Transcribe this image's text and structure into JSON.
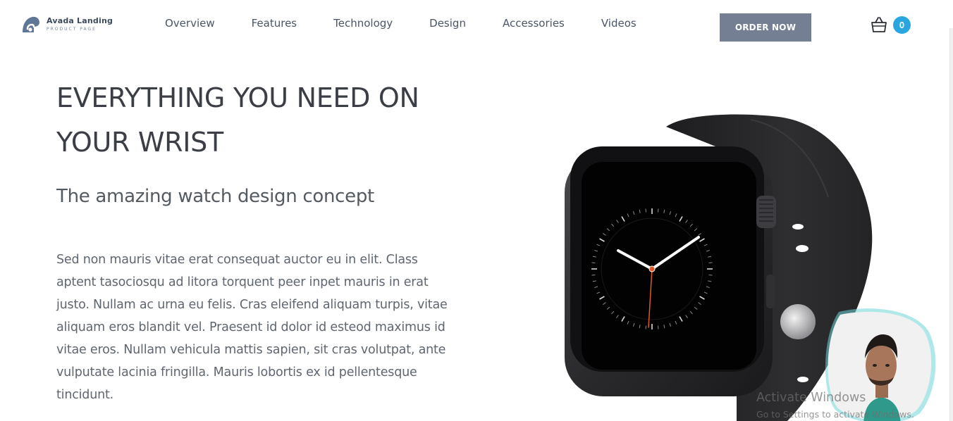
{
  "brand": {
    "name": "Avada Landing",
    "tagline": "PRODUCT PAGE",
    "logo_color": "#5f7796"
  },
  "nav": {
    "items": [
      "Overview",
      "Features",
      "Technology",
      "Design",
      "Accessories",
      "Videos"
    ]
  },
  "header": {
    "order_label": "ORDER NOW",
    "order_color": "#747f94",
    "cart_icon": "shopping-basket-icon",
    "cart_count": "0",
    "cart_badge_color": "#29a6e0"
  },
  "hero": {
    "title": "EVERYTHING YOU NEED ON YOUR WRIST",
    "subtitle": "The amazing watch design concept",
    "body": "Sed non mauris vitae erat consequat auctor eu in elit. Class aptent tasociosqu ad litora torquent peer inpet mauris in erat justo. Nullam ac urna eu felis. Cras eleifend aliquam turpis, vitae aliquam eros blandit vel. Praesent id dolor id esteod maximus id vitae eros. Nullam vehicula mattis sapien, sit cras volutpat, ante vulputate lacinia fringilla. Mauris lobortis ex id pellentesque tincidunt."
  },
  "product": {
    "image": "smartwatch-image",
    "face_colors": {
      "hands": "#ffffff",
      "second_hand": "#e0582a"
    }
  },
  "overlay": {
    "webcam": "webcam-person-image",
    "activation_title": "Activate Windows",
    "activation_sub": "Go to Settings to activate Windows."
  }
}
